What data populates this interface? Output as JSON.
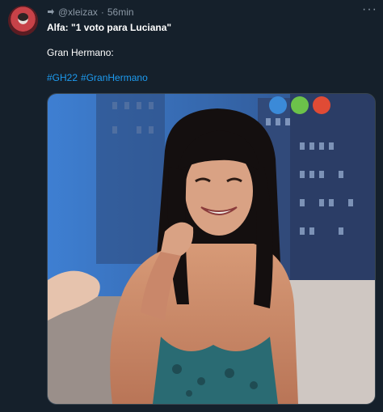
{
  "author": {
    "handle": "@xleizax",
    "time": "56min",
    "separator": "·",
    "avatar_icon": "profile-avatar"
  },
  "tweet": {
    "line1_prefix": "Alfa: \"1 voto para ",
    "line1_name": "Luciana\"",
    "line2": "Gran Hermano:",
    "hashtags": [
      "#GH22",
      "#GranHermano"
    ]
  },
  "menu": {
    "more_label": "···"
  },
  "colors": {
    "background": "#15202b",
    "muted": "#8b98a5",
    "link": "#1d9bf0",
    "text": "#ffffff",
    "logo_blue": "#3b8ad8",
    "logo_green": "#6cc24a",
    "logo_red": "#e04b35"
  }
}
